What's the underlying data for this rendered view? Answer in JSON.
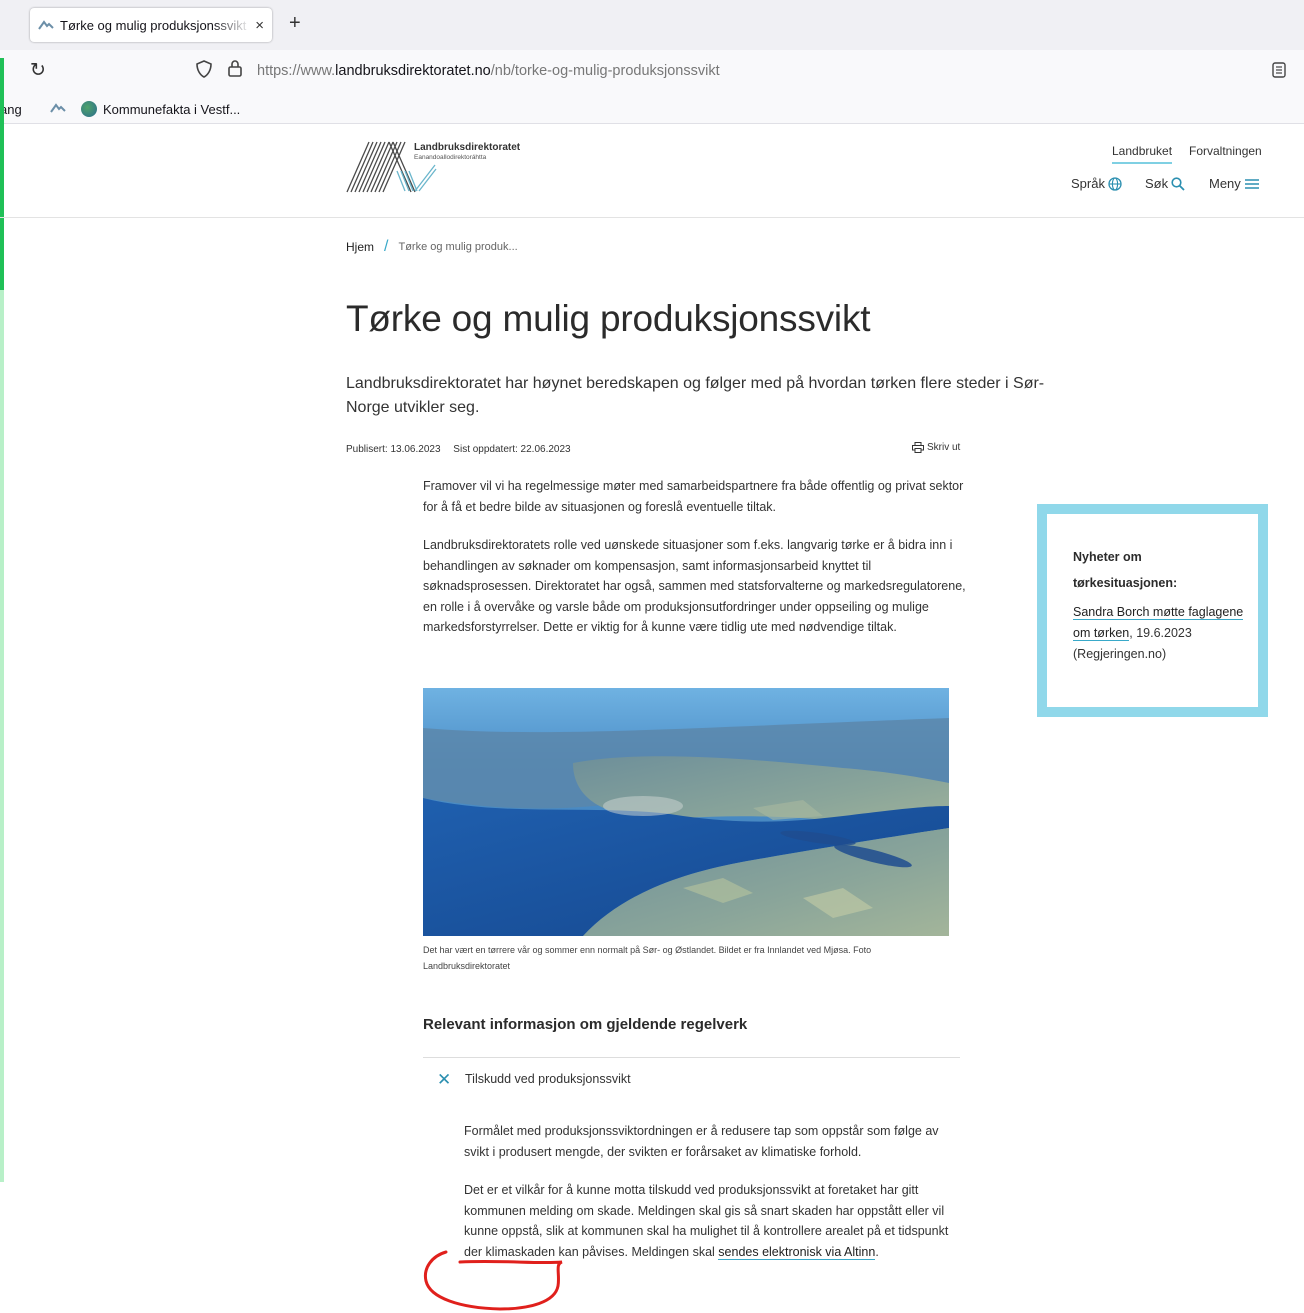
{
  "browser": {
    "tab_title": "Tørke og mulig produksjonssvikt",
    "tab_close": "×",
    "new_tab": "+",
    "url_prefix": "https://www.",
    "url_domain": "landbruksdirektoratet.no",
    "url_path": "/nb/torke-og-mulig-produksjonssvikt",
    "bookmarks": [
      "ang",
      "Kommunefakta i Vestf..."
    ]
  },
  "header": {
    "logo_name": "Landbruksdirektoratet",
    "logo_subtitle": "Eanandoallodirektoráhtta",
    "top_links": [
      "Landbruket",
      "Forvaltningen"
    ],
    "language_label": "Språk",
    "search_label": "Søk",
    "menu_label": "Meny"
  },
  "breadcrumb": {
    "home": "Hjem",
    "separator": "/",
    "current": "Tørke og mulig produk..."
  },
  "article": {
    "title": "Tørke og mulig produksjonssvikt",
    "ingress": "Landbruksdirektoratet har høynet beredskapen og følger med på hvordan tørken flere steder i Sør-Norge utvikler seg.",
    "published": "Publisert: 13.06.2023",
    "updated": "Sist oppdatert: 22.06.2023",
    "print_label": "Skriv ut",
    "paragraph1": "Framover vil vi ha regelmessige møter med samarbeidspartnere fra både offentlig og privat sektor for å få et bedre bilde av situasjonen og foreslå eventuelle tiltak.",
    "paragraph2": "Landbruksdirektoratets rolle ved uønskede situasjoner som f.eks. langvarig tørke er å bidra inn i behandlingen av søknader om kompensasjon, samt informasjonsarbeid knyttet til søknadsprosessen. Direktoratet har også, sammen med statsforvalterne og markedsregulatorene, en rolle i å overvåke og varsle både om produksjonsutfordringer under oppseiling og mulige markedsforstyrrelser. Dette er viktig for å kunne være tidlig ute med nødvendige tiltak.",
    "image_caption": "Det har vært en tørrere vår og sommer enn normalt på Sør- og Østlandet. Bildet er fra Innlandet ved Mjøsa. Foto Landbruksdirektoratet",
    "relevant_heading": "Relevant informasjon om gjeldende regelverk",
    "accordion": {
      "title": "Tilskudd ved produksjonssvikt",
      "paragraph1": "Formålet med produksjonssviktordningen er å redusere tap som oppstår som følge av svikt i produsert mengde, der svikten er forårsaket av klimatiske forhold.",
      "paragraph2_text": "Det er et vilkår for å kunne motta tilskudd ved produksjonssvikt at foretaket har gitt kommunen melding om skade. Meldingen skal gis så snart skaden har oppstått eller vil kunne oppstå, slik at kommunen skal ha mulighet til å kontrollere arealet på et tidspunkt der klimaskaden kan påvises. Meldingen skal ",
      "paragraph2_link": "sendes elektronisk via Altinn",
      "paragraph2_end": "."
    }
  },
  "sidebar": {
    "heading": "Nyheter om tørkesituasjonen:",
    "link_text": "Sandra Borch møtte faglagene om tørken",
    "suffix": ", 19.6.2023 (Regjeringen.no)"
  },
  "colors": {
    "accent": "#39a9c9",
    "news_border": "#90d8ea",
    "annotation": "#e0201c"
  }
}
